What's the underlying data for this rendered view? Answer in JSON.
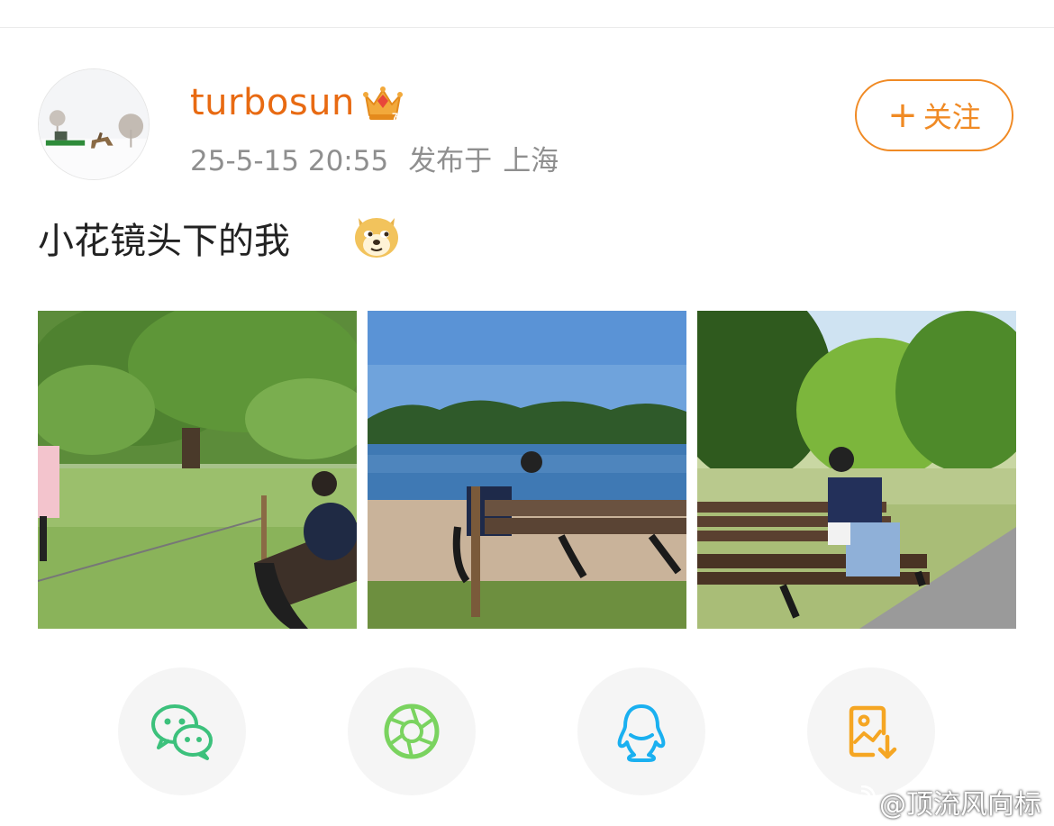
{
  "post": {
    "username": "turbosun",
    "timestamp": "25-5-15 20:55",
    "location_prefix": "发布于",
    "location": "上海",
    "text": "小花镜头下的我",
    "emoji": "doge-emoji"
  },
  "follow_button": {
    "label": "关注",
    "icon": "plus-icon"
  },
  "badge": {
    "icon": "crown-icon",
    "color": "#f2a93b"
  },
  "photos": [
    {
      "icon": "photo-park-tree-bench"
    },
    {
      "icon": "photo-lake-bench"
    },
    {
      "icon": "photo-park-bench-trees"
    }
  ],
  "share_actions": [
    {
      "icon": "wechat-icon",
      "color": "#3cc17c"
    },
    {
      "icon": "moments-icon",
      "color": "#7ad35f"
    },
    {
      "icon": "qq-icon",
      "color": "#1ab0f0"
    },
    {
      "icon": "save-image-icon",
      "color": "#f5a623"
    }
  ],
  "watermark": {
    "text": "@顶流风向标"
  },
  "colors": {
    "username": "#e86a12",
    "follow_accent": "#f08a24",
    "meta": "#8f8f8f"
  }
}
